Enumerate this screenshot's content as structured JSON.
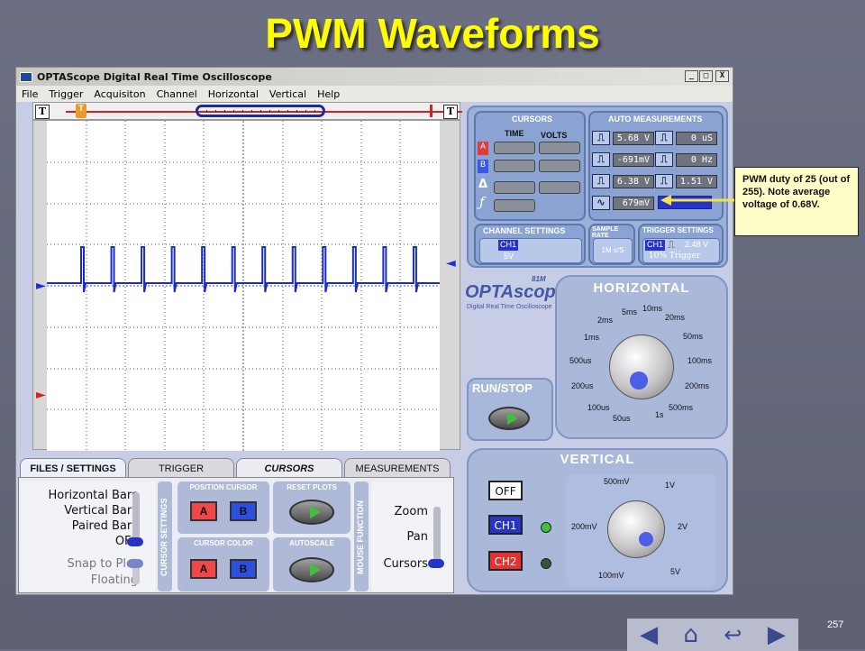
{
  "slide": {
    "title": "PWM Waveforms",
    "page_number": "257"
  },
  "window": {
    "title": "OPTAScope Digital Real Time Oscilloscope",
    "controls": [
      "_",
      "□",
      "X"
    ]
  },
  "menu": [
    "File",
    "Trigger",
    "Acquisiton",
    "Channel",
    "Horizontal",
    "Vertical",
    "Help"
  ],
  "timebar": {
    "left_label": "T",
    "right_label": "T",
    "trigger_marker": "T"
  },
  "waveform": {
    "signal": "PWM",
    "pulse_count": 13,
    "color": "#1a2cc8",
    "channel_markers": [
      "►",
      "►"
    ],
    "trigger_level_marker": "◄"
  },
  "cursors": {
    "title": "CURSORS",
    "col_time": "TIME",
    "col_volts": "VOLTS",
    "cursor_a": "A",
    "cursor_b": "B",
    "delta": "Δ",
    "freq": "ƒ"
  },
  "auto_measurements": {
    "title": "AUTO MEASUREMENTS",
    "items": [
      {
        "icon": "pulse-high-icon",
        "value": "5.68 V"
      },
      {
        "icon": "rise-time-icon",
        "value": "0 uS"
      },
      {
        "icon": "pulse-low-icon",
        "value": "-691mV"
      },
      {
        "icon": "frequency-icon",
        "value": "0 Hz"
      },
      {
        "icon": "pulse-amplitude-icon",
        "value": "6.38 V"
      },
      {
        "icon": "period-icon",
        "value": "1.51 V"
      },
      {
        "icon": "average-icon",
        "value": "679mV"
      },
      {
        "icon": "rms-icon",
        "value": ""
      }
    ]
  },
  "channel_settings": {
    "title": "CHANNEL SETTINGS",
    "channel": "CH1",
    "scale": "5V"
  },
  "sample_rate": {
    "title": "SAMPLE RATE",
    "value": "1M s/S"
  },
  "trigger_settings": {
    "title": "TRIGGER SETTINGS",
    "channel": "CH1",
    "level": "2.48 V",
    "mode": "10% Trigger"
  },
  "callout": {
    "text": "PWM duty of 25 (out of 255).  Note average voltage of 0.68V."
  },
  "brand": {
    "name": "OPTAscope",
    "model": "81M",
    "subtitle": "Digital Real Time Oscilloscope"
  },
  "horizontal": {
    "title": "HORIZONTAL",
    "labels": [
      "5ms",
      "10ms",
      "2ms",
      "20ms",
      "1ms",
      "50ms",
      "500us",
      "100ms",
      "200us",
      "200ms",
      "100us",
      "500ms",
      "50us",
      "1s"
    ]
  },
  "runstop": {
    "title": "RUN/STOP"
  },
  "vertical": {
    "title": "VERTICAL",
    "channels": [
      {
        "label": "OFF"
      },
      {
        "label": "CH1"
      },
      {
        "label": "CH2"
      }
    ],
    "labels": [
      "500mV",
      "1V",
      "200mV",
      "2V",
      "100mV",
      "5V"
    ]
  },
  "tabs": [
    "FILES / SETTINGS",
    "TRIGGER",
    "CURSORS",
    "MEASUREMENTS"
  ],
  "cursor_settings": {
    "vertical_title": "CURSOR SETTINGS",
    "options": [
      "Horizontal Bars",
      "Vertical Bars",
      "Paired Bars",
      "OFF"
    ],
    "mode_options": [
      "Snap to Plot",
      "Floating"
    ],
    "position_cursor": {
      "title": "POSITION CURSOR",
      "a": "A",
      "b": "B"
    },
    "cursor_color": {
      "title": "CURSOR COLOR",
      "a": "A",
      "b": "B"
    },
    "reset_plots": {
      "title": "RESET PLOTS"
    },
    "autoscale": {
      "title": "AUTOSCALE"
    },
    "mouse_function": {
      "vertical_title": "MOUSE FUNCTION",
      "options": [
        "Zoom",
        "Pan",
        "Cursors"
      ]
    }
  },
  "nav": [
    "◀",
    "⌂",
    "↩",
    "▶"
  ]
}
